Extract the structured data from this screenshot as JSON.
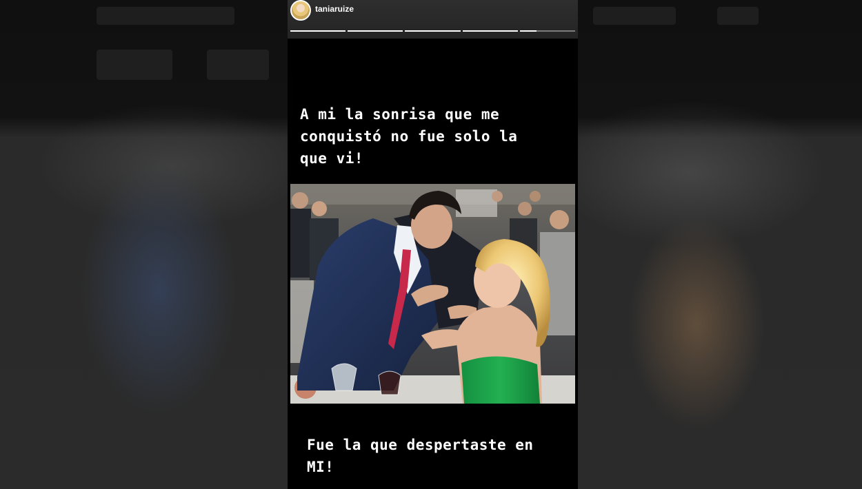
{
  "story": {
    "username": "taniaruize",
    "progress_segments": [
      1,
      1,
      1,
      1,
      0.3
    ],
    "caption_top": "A mi la sonrisa que me\nconquistó no fue solo la\nque vi!",
    "caption_bottom": "Fue la que despertaste en\nMI!",
    "colors": {
      "background": "#000000",
      "text": "#ffffff",
      "dress": "#1fa34a",
      "tie": "#c8294a",
      "suit": "#1e2f55"
    }
  }
}
